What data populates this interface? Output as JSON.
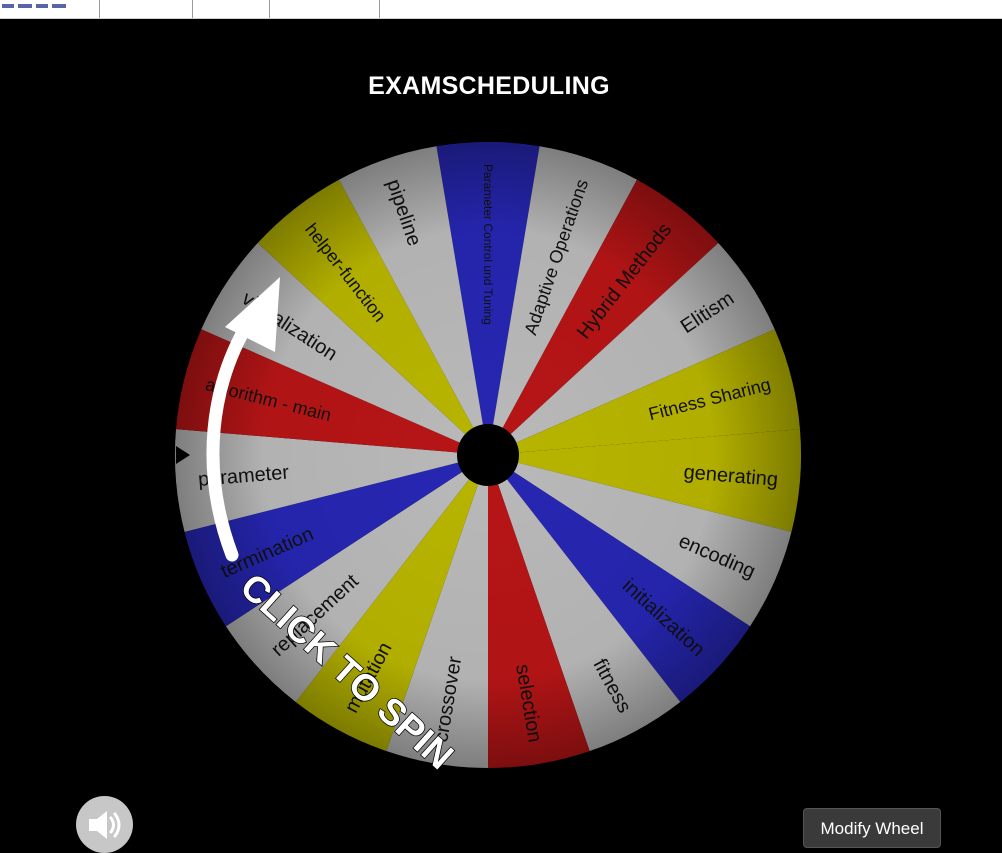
{
  "wheel_title": "EXAMSCHEDULING",
  "call_to_action": "CLICK TO SPIN",
  "modify_button_label": "Modify Wheel",
  "colors": {
    "red": "#b71516",
    "grey": "#b9b9b9",
    "yellow": "#b8b500",
    "blue": "#2626b2"
  },
  "wheel": {
    "segments": [
      {
        "label": "Parameter Control und Tuning",
        "color": "blue"
      },
      {
        "label": "Adaptive Operations",
        "color": "grey"
      },
      {
        "label": "Hybrid Methods",
        "color": "red"
      },
      {
        "label": "Elitism",
        "color": "grey"
      },
      {
        "label": "Fitness Sharing",
        "color": "yellow"
      },
      {
        "label": "generating",
        "color": "yellow"
      },
      {
        "label": "encoding",
        "color": "grey"
      },
      {
        "label": "initialization",
        "color": "blue"
      },
      {
        "label": "fitness",
        "color": "grey"
      },
      {
        "label": "selection",
        "color": "red"
      },
      {
        "label": "crossover",
        "color": "grey"
      },
      {
        "label": "mutation",
        "color": "yellow"
      },
      {
        "label": "replacement",
        "color": "grey"
      },
      {
        "label": "termination",
        "color": "blue"
      },
      {
        "label": "parameter",
        "color": "grey"
      },
      {
        "label": "algorithm - main",
        "color": "red"
      },
      {
        "label": "visualization",
        "color": "grey"
      },
      {
        "label": "helper-function",
        "color": "yellow"
      },
      {
        "label": "pipeline",
        "color": "grey"
      }
    ]
  },
  "icons": {
    "sound": "speaker-icon",
    "spin_arrow": "arrow-icon",
    "pointer": "triangle-pointer-icon"
  }
}
